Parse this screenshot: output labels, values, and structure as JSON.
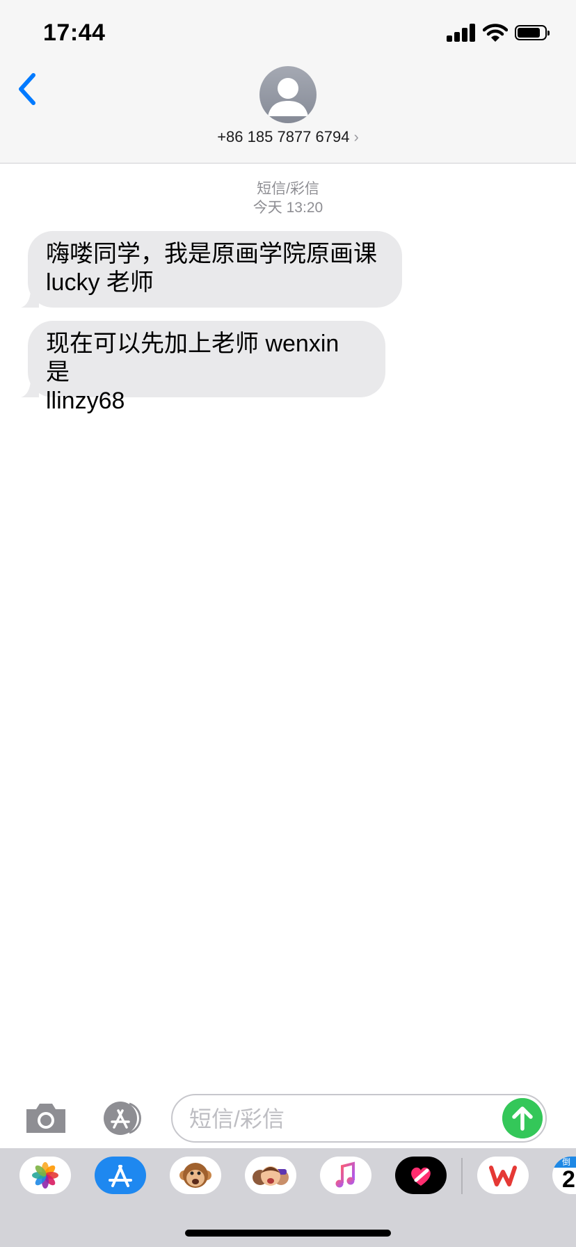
{
  "status_bar": {
    "time": "17:44",
    "icons": [
      "cellular-signal-icon",
      "wifi-icon",
      "battery-icon"
    ]
  },
  "header": {
    "back_icon": "chevron-left-icon",
    "avatar_icon": "person-silhouette-icon",
    "contact_number": "+86 185 7877 6794",
    "contact_chevron": "›"
  },
  "conversation": {
    "service_label": "短信/彩信",
    "timestamp": "今天 13:20",
    "messages": [
      {
        "direction": "incoming",
        "lines": [
          "嗨喽同学，我是原画学院原画课",
          "lucky 老师"
        ]
      },
      {
        "direction": "incoming",
        "lines": [
          "现在可以先加上老师 wenxin 是",
          "llinzy68"
        ]
      }
    ]
  },
  "input_bar": {
    "camera_icon": "camera-icon",
    "apps_icon": "app-store-icon",
    "placeholder": "短信/彩信",
    "value": "",
    "send_icon": "arrow-up-icon"
  },
  "app_drawer": {
    "apps": [
      "photos-icon",
      "app-store-icon",
      "animoji-icon",
      "memoji-icon",
      "music-icon",
      "digital-touch-icon",
      "wps-icon",
      "calendar-icon"
    ],
    "calendar_partial_text": "倒",
    "calendar_partial_number": "2"
  },
  "colors": {
    "accent": "#007aff",
    "incoming_bubble": "#e9e9eb",
    "send_button": "#34c759",
    "header_bg": "#f6f6f6",
    "drawer_bg": "#d3d3d8"
  }
}
